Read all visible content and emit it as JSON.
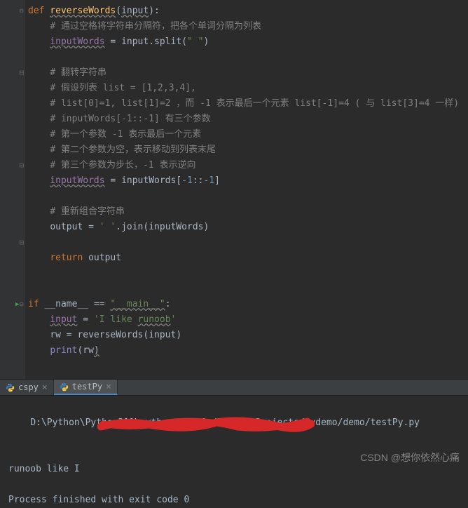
{
  "code": {
    "l1_def": "def ",
    "l1_fn": "reverseWords",
    "l1_paren_open": "(",
    "l1_param": "input",
    "l1_paren_close": "):",
    "l2_cmt": "# 通过空格将字符串分隔符，把各个单词分隔为列表",
    "l3_var": "inputWords",
    "l3_eq": " = input.split(",
    "l3_str": "\" \"",
    "l3_close": ")",
    "l5_cmt": "# 翻转字符串",
    "l6_cmt": "# 假设列表 list = [1,2,3,4],",
    "l7_cmt": "# list[0]=1, list[1]=2 ，而 -1 表示最后一个元素 list[-1]=4 ( 与 list[3]=4 一样)",
    "l8_cmt": "# inputWords[-1::-1] 有三个参数",
    "l9_cmt": "# 第一个参数 -1 表示最后一个元素",
    "l10_cmt": "# 第二个参数为空，表示移动到列表末尾",
    "l11_cmt": "# 第三个参数为步长，-1 表示逆向",
    "l12_var": "inputWords",
    "l12_mid": " = inputWords[",
    "l12_n1": "-1",
    "l12_colon": "::",
    "l12_n2": "-1",
    "l12_close": "]",
    "l14_cmt": "# 重新组合字符串",
    "l15_out": "output = ",
    "l15_str": "' '",
    "l15_join": ".join(inputWords)",
    "l17_ret": "return ",
    "l17_var": "output",
    "l20_if": "if ",
    "l20_name": "__name__ == ",
    "l20_main": "\"__main__\"",
    "l20_colon": ":",
    "l21_var": "input",
    "l21_eq": " = ",
    "l21_str1": "'I like ",
    "l21_str2": "runoob",
    "l21_str3": "'",
    "l22": "rw = reverseWords(input)",
    "l23_print": "print",
    "l23_rest": "(rw",
    "l23_paren": ")"
  },
  "tabs": [
    {
      "label": "cspy",
      "active": false
    },
    {
      "label": "testPy",
      "active": true
    }
  ],
  "console": {
    "line1_prefix": "D:\\Python\\Python311\\python.exe C:/PycharmProjects/mydemo/",
    "line1_suffix": "demo/testPy.py",
    "line2": "runoob like I",
    "line4": "Process finished with exit code 0"
  },
  "watermark": "CSDN @想你依然心痛"
}
